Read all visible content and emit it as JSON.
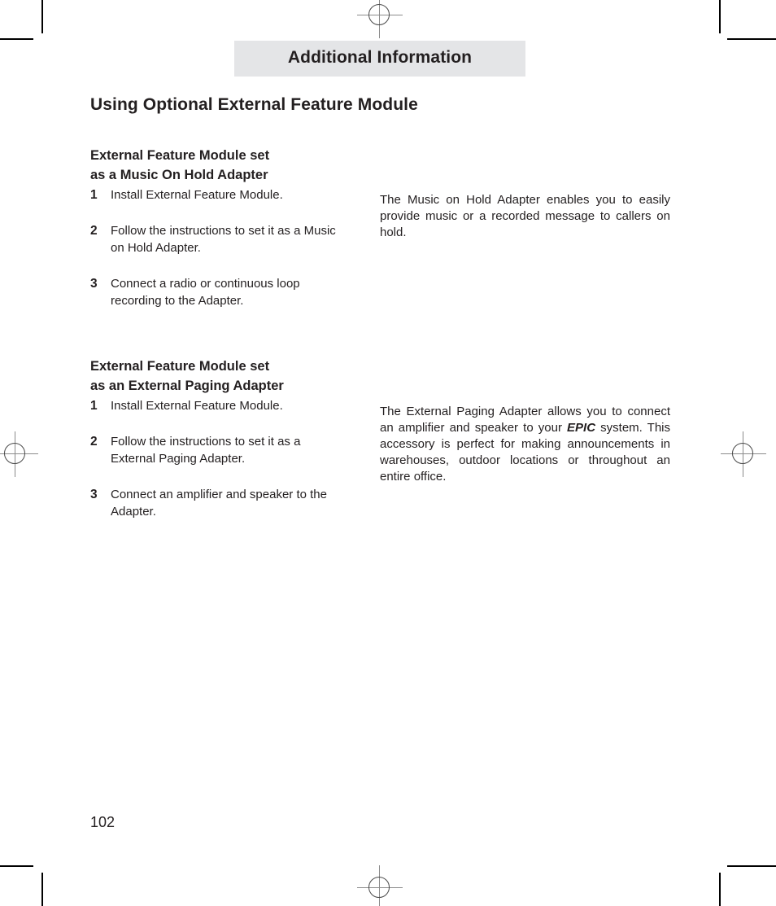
{
  "header": {
    "banner_title": "Additional Information"
  },
  "page_title": "Using Optional External Feature Module",
  "sections": [
    {
      "heading_line1": "External Feature Module set",
      "heading_line2": "as a Music On Hold Adapter",
      "steps": [
        {
          "number": "1",
          "text": "Install External Feature Module."
        },
        {
          "number": "2",
          "text": "Follow the instructions to set it as a Music on Hold Adapter."
        },
        {
          "number": "3",
          "text": "Connect a radio or continuous loop recording to the Adapter."
        }
      ],
      "description_before": "The Music on Hold Adapter enables you to easily provide music or a recorded message to callers on hold.",
      "description_emphasis": "",
      "description_after": ""
    },
    {
      "heading_line1": "External Feature Module set",
      "heading_line2": "as an External Paging Adapter",
      "steps": [
        {
          "number": "1",
          "text": "Install External Feature Module."
        },
        {
          "number": "2",
          "text": "Follow the instructions to set it as a External Paging Adapter."
        },
        {
          "number": "3",
          "text": "Connect an amplifier and speaker to the Adapter."
        }
      ],
      "description_before": "The External Paging Adapter allows you to connect an amplifier and speaker to your ",
      "description_emphasis": "EPIC",
      "description_after": " system.  This accessory is perfect for making announcements in warehouses, outdoor locations or throughout an entire office."
    }
  ],
  "folio": "102",
  "colors": {
    "banner_background": "#e4e5e7",
    "text": "#231f20",
    "registration_mark": "#8b8b8b",
    "crop_mark": "#000000"
  }
}
